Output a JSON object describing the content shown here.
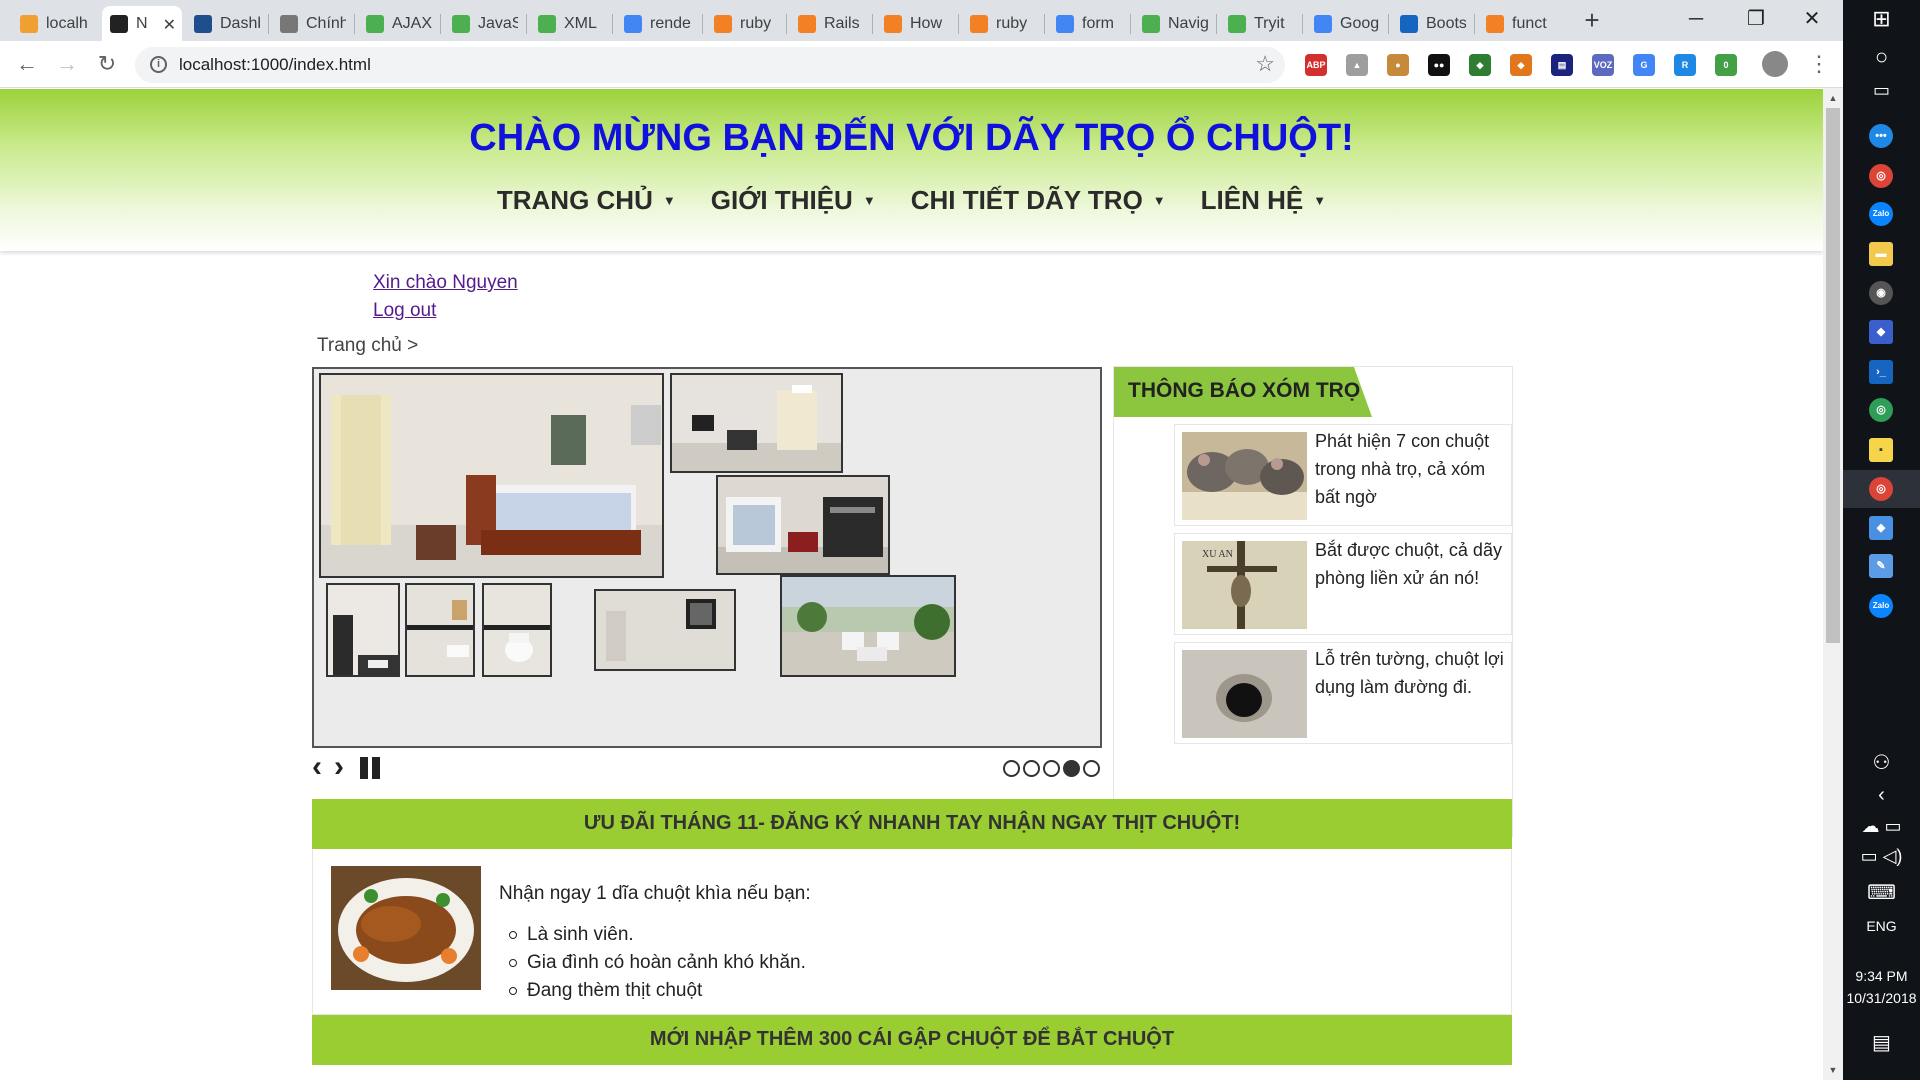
{
  "browser": {
    "tabs": [
      {
        "label": "localh",
        "icon": "pma-icon",
        "color": "#f0a030"
      },
      {
        "label": "N",
        "icon": "github-icon",
        "color": "#222222",
        "active": true
      },
      {
        "label": "Dashb",
        "icon": "doc-icon",
        "color": "#1e4e8c"
      },
      {
        "label": "Chính",
        "icon": "page-icon",
        "color": "#777777"
      },
      {
        "label": "AJAX",
        "icon": "w3-icon",
        "color": "#4caf50"
      },
      {
        "label": "JavaS",
        "icon": "w3-icon",
        "color": "#4caf50"
      },
      {
        "label": "XML",
        "icon": "w3-icon",
        "color": "#4caf50"
      },
      {
        "label": "rende",
        "icon": "google-icon",
        "color": "#4285f4"
      },
      {
        "label": "ruby",
        "icon": "stackoverflow-icon",
        "color": "#f48024"
      },
      {
        "label": "Rails",
        "icon": "stackoverflow-icon",
        "color": "#f48024"
      },
      {
        "label": "How",
        "icon": "stackoverflow-icon",
        "color": "#f48024"
      },
      {
        "label": "ruby",
        "icon": "stackoverflow-icon",
        "color": "#f48024"
      },
      {
        "label": "form",
        "icon": "google-icon",
        "color": "#4285f4"
      },
      {
        "label": "Navig",
        "icon": "w3-icon",
        "color": "#4caf50"
      },
      {
        "label": "Tryit",
        "icon": "w3-icon",
        "color": "#4caf50"
      },
      {
        "label": "Goog",
        "icon": "google-icon",
        "color": "#4285f4"
      },
      {
        "label": "Boots",
        "icon": "bootstrap-icon",
        "color": "#1565c0"
      },
      {
        "label": "funct",
        "icon": "stackoverflow-icon",
        "color": "#f48024"
      }
    ],
    "url": "localhost:1000/index.html",
    "extensions": [
      {
        "name": "adblock-icon",
        "text": "ABP",
        "color": "#d32f2f"
      },
      {
        "name": "drive-icon",
        "text": "▲",
        "color": "#9e9e9e"
      },
      {
        "name": "cookie-icon",
        "text": "●",
        "color": "#c68a3a"
      },
      {
        "name": "tampermonkey-icon",
        "text": "●●",
        "color": "#111111"
      },
      {
        "name": "globe-icon",
        "text": "◆",
        "color": "#2e7d32"
      },
      {
        "name": "metamask-icon",
        "text": "◆",
        "color": "#e2761b"
      },
      {
        "name": "screen-icon",
        "text": "▤",
        "color": "#1a237e"
      },
      {
        "name": "voz-icon",
        "text": "VOZ",
        "color": "#5c6bc0"
      },
      {
        "name": "translate-icon",
        "text": "G",
        "color": "#4285f4"
      },
      {
        "name": "reader-icon",
        "text": "R",
        "color": "#1e88e5"
      },
      {
        "name": "badge-extension-icon",
        "text": "0",
        "color": "#43a047"
      }
    ]
  },
  "site": {
    "title": "CHÀO MỪNG BẠN ĐẾN VỚI DÃY TRỌ Ổ CHUỘT!",
    "nav": [
      "TRANG CHỦ",
      "GIỚI THIỆU",
      "CHI TIẾT DÃY TRỌ",
      "LIÊN HỆ"
    ],
    "greeting": "Xin chào Nguyen",
    "logout": "Log out",
    "breadcrumb": "Trang chủ >"
  },
  "slideshow": {
    "total_slides": 5,
    "active_slide": 4
  },
  "notices": {
    "title": "THÔNG BÁO XÓM TRỌ",
    "items": [
      {
        "text": "Phát hiện 7 con chuột trong nhà trọ, cả xóm bất ngờ"
      },
      {
        "text": "Bắt được chuột, cả dãy phòng liền xử án nó!"
      },
      {
        "text": "Lỗ trên tường, chuột lợi dụng làm đường đi."
      }
    ]
  },
  "promotions": {
    "bar1": "ƯU ĐÃI THÁNG 11- ĐĂNG KÝ NHANH TAY NHẬN NGAY THỊT CHUỘT!",
    "intro": "Nhận ngay 1 dĩa chuột khìa nếu bạn:",
    "conditions": [
      "Là sinh viên.",
      "Gia đình có hoàn cảnh khó khăn.",
      "Đang thèm thịt chuột"
    ],
    "bar2": "MỚI NHẬP THÊM 300 CÁI GẬP CHUỘT ĐỂ BẮT CHUỘT"
  },
  "taskbar": {
    "language": "ENG",
    "time": "9:34 PM",
    "date": "10/31/2018"
  }
}
